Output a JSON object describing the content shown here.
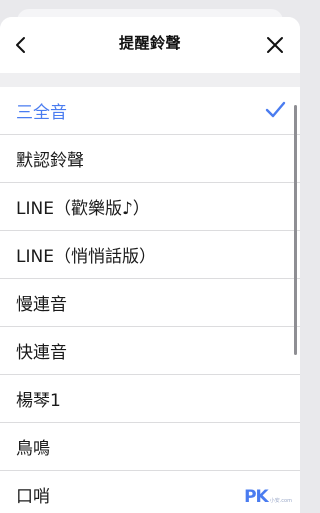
{
  "header": {
    "title": "提醒鈴聲",
    "back_icon": "chevron-left-icon",
    "close_icon": "close-icon"
  },
  "list": {
    "items": [
      {
        "label": "三全音",
        "selected": true
      },
      {
        "label": "默認鈴聲",
        "selected": false
      },
      {
        "label": "LINE（歡樂版♪）",
        "selected": false
      },
      {
        "label": "LINE（悄悄話版）",
        "selected": false
      },
      {
        "label": "慢連音",
        "selected": false
      },
      {
        "label": "快連音",
        "selected": false
      },
      {
        "label": "楊琴1",
        "selected": false
      },
      {
        "label": "鳥鳴",
        "selected": false
      },
      {
        "label": "口哨",
        "selected": false
      }
    ],
    "check_icon": "checkmark-icon"
  },
  "watermark": {
    "text": "PK",
    "sub": "小安.com"
  },
  "colors": {
    "accent": "#4a7cf0",
    "text": "#1a1a1a",
    "divider": "#dcdcde",
    "band": "#efeff1"
  }
}
